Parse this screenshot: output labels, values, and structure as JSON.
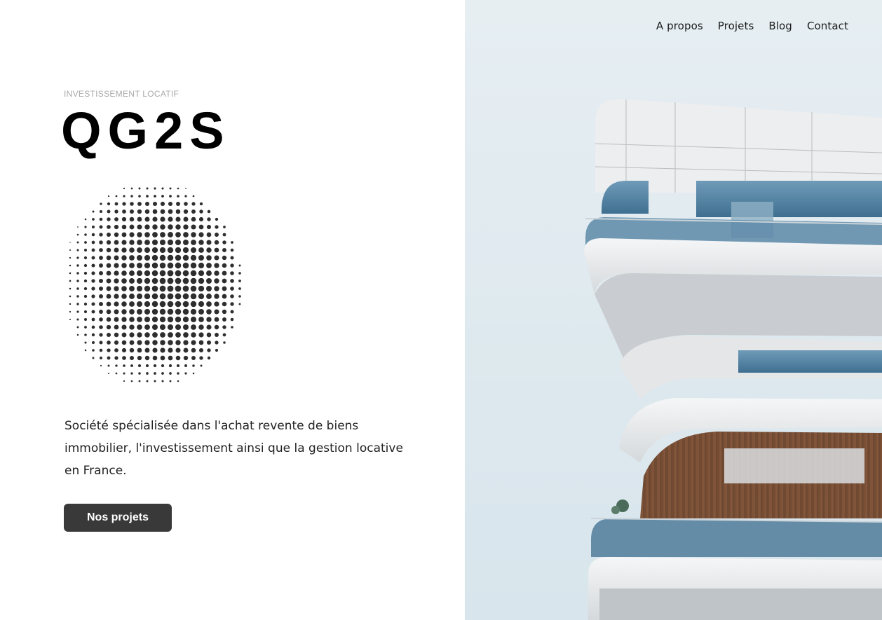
{
  "nav": {
    "items": [
      {
        "label": "A propos"
      },
      {
        "label": "Projets"
      },
      {
        "label": "Blog"
      },
      {
        "label": "Contact"
      }
    ]
  },
  "hero": {
    "eyebrow": "INVESTISSEMENT LOCATIF",
    "title": "QG2S",
    "description": "Société spécialisée dans l'achat revente de biens immobilier, l'investissement ainsi que la gestion locative en France.",
    "cta_label": "Nos projets"
  },
  "colors": {
    "accent_button": "#393939",
    "sky": "#dfe9ee",
    "text_dark": "#222222"
  }
}
